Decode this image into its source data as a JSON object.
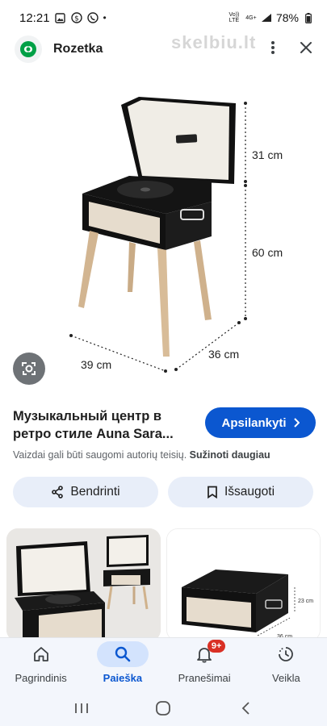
{
  "status_bar": {
    "time": "12:21",
    "network": "Vo)) LTE",
    "signal_label": "4G+",
    "battery": "78%"
  },
  "header": {
    "site_name": "Rozetka",
    "watermark": "skelbiu.lt"
  },
  "hero": {
    "dimensions": {
      "lid_height": "31 cm",
      "leg_height": "60 cm",
      "depth": "36 cm",
      "width": "39 cm"
    }
  },
  "product": {
    "title_line1": "Музыкальный центр в",
    "title_line2": "ретро стиле Auna Sara...",
    "visit_label": "Apsilankyti"
  },
  "copyright": {
    "text": "Vaizdai gali būti saugomi autorių teisių.",
    "learn_more": "Sužinoti daugiau"
  },
  "actions": {
    "share_label": "Bendrinti",
    "save_label": "Išsaugoti"
  },
  "thumbnails": {
    "thumb2_dims": {
      "height": "23 cm",
      "depth": "36 cm"
    }
  },
  "bottom_nav": {
    "items": [
      {
        "label": "Pagrindinis",
        "icon": "home-icon"
      },
      {
        "label": "Paieška",
        "icon": "search-icon"
      },
      {
        "label": "Pranešimai",
        "icon": "bell-icon",
        "badge": "9+"
      },
      {
        "label": "Veikla",
        "icon": "activity-icon"
      }
    ],
    "active_index": 1
  },
  "colors": {
    "accent": "#0b57d0",
    "pill_bg": "#e8eef9",
    "badge": "#d93025"
  }
}
